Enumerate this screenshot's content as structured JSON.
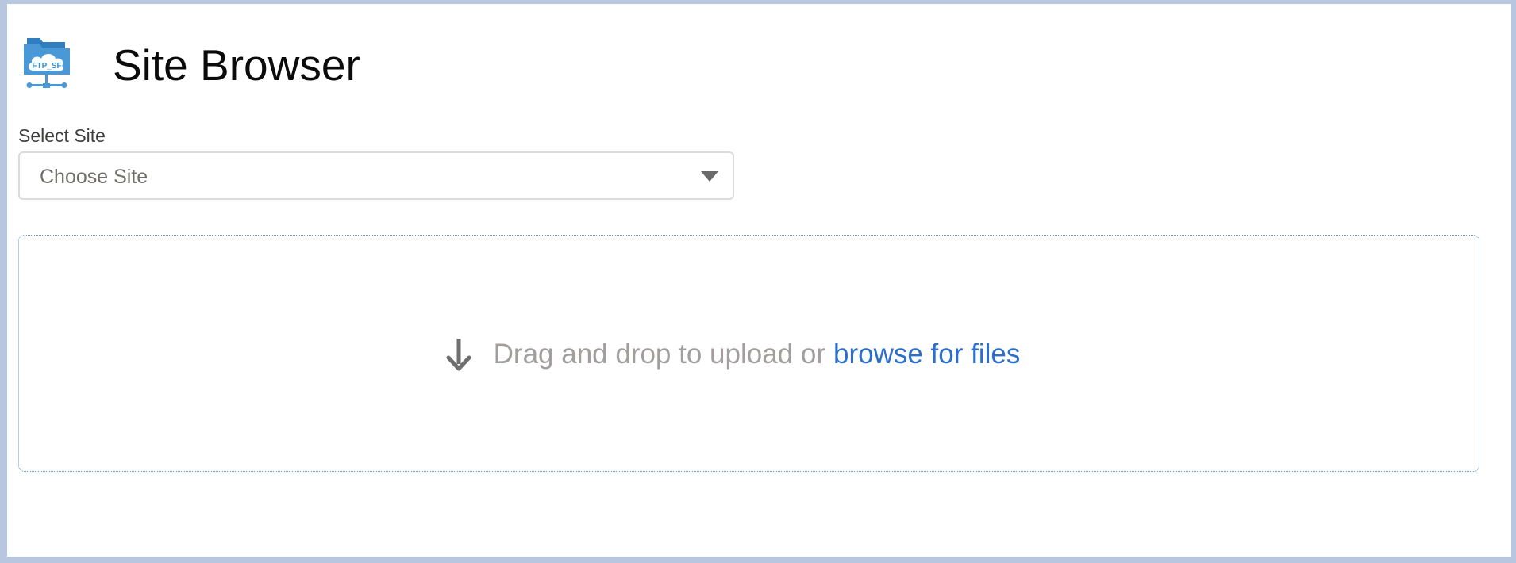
{
  "header": {
    "logo_icon": "ftp-sf-folder-cloud-icon",
    "logo_text": "FTP_SF",
    "title": "Site Browser"
  },
  "site_select": {
    "label": "Select Site",
    "value": "Choose Site",
    "caret_icon": "chevron-down-icon"
  },
  "dropzone": {
    "icon": "arrow-down-icon",
    "text": "Drag and drop to upload or",
    "link": "browse for files"
  },
  "colors": {
    "frame": "#b8c6e0",
    "link": "#2b6fcb",
    "logo_blue": "#4a98d6",
    "dropzone_border": "#5d9ce0"
  }
}
